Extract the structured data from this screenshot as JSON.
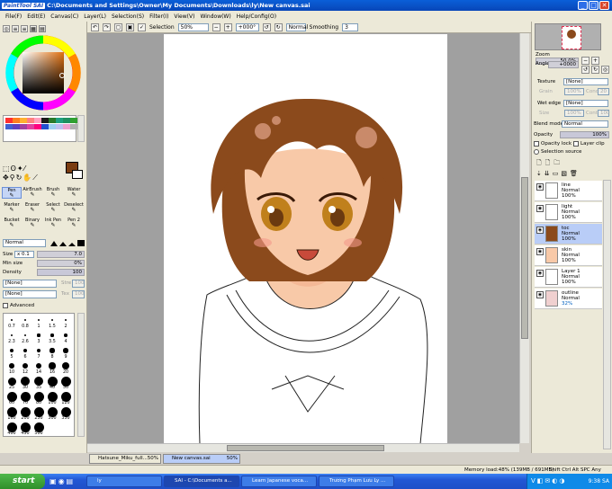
{
  "window": {
    "logo": "PaintTool SAI",
    "title": "C:\\Documents and Settings\\Owner\\My Documents\\Downloads\\ly\\New canvas.sai",
    "minimize": "_",
    "maximize": "□",
    "close": "✕"
  },
  "menu": [
    "File(F)",
    "Edit(E)",
    "Canvas(C)",
    "Layer(L)",
    "Selection(S)",
    "Filter(I)",
    "View(V)",
    "Window(W)",
    "Help/Config(O)"
  ],
  "toolbar": {
    "selection_label": "Selection",
    "zoom": "50%",
    "angle": "+000°",
    "blend": "Normal",
    "smoothing_label": "Smoothing",
    "smoothing": "3"
  },
  "colors": {
    "accent": "#0a5fd8",
    "brown": "#7a3c10",
    "hair": "#8b4a1c",
    "skin": "#f8c9a8",
    "eyes": "#c0801c"
  },
  "palette": [
    "#ff3030",
    "#ff8020",
    "#ffb030",
    "#ff8080",
    "#ffa0c0",
    "#1a1a1a",
    "#2a7a2a",
    "#20a080",
    "#209060",
    "#30a030",
    "#4060d0",
    "#6040c0",
    "#a040a0",
    "#e040a0",
    "#ff0080",
    "#2050d0",
    "#a0d0f0",
    "#c0c0f0",
    "#f0a0d0",
    "#b0b0b0"
  ],
  "tools": {
    "row1": [
      "Pen",
      "AirBrush",
      "Brush",
      "Water"
    ],
    "row2": [
      "Marker",
      "Eraser",
      "Select",
      "Deselect"
    ],
    "row3": [
      "Bucket",
      "Binary",
      "Ink Pen",
      "Pen 2"
    ]
  },
  "brush": {
    "mode": "Normal",
    "size_label": "Size",
    "size_mult": "x 0.1",
    "size_value": "7.0",
    "minsize_label": "Min size",
    "minsize_value": "0%",
    "density_label": "Density",
    "density_value": "100",
    "none1": "[None]",
    "none2": "[None]",
    "stre_label": "Stre",
    "stre_value": "100",
    "tex_label": "Tex",
    "tex_value": "100",
    "advanced_label": "Advanced"
  },
  "brush_sizes": [
    "0.7",
    "0.8",
    "1",
    "1.5",
    "2",
    "2.3",
    "2.6",
    "3",
    "3.5",
    "4",
    "5",
    "6",
    "7",
    "8",
    "9",
    "10",
    "12",
    "14",
    "16",
    "20",
    "25",
    "30",
    "35",
    "40",
    "50",
    "60",
    "70",
    "80",
    "100",
    "120",
    "160",
    "200",
    "250",
    "300",
    "350",
    "400",
    "450",
    "500"
  ],
  "navigator": {
    "zoom_label": "Zoom",
    "zoom_value": "50.0%",
    "angle_label": "Angle",
    "angle_value": "+0000"
  },
  "layer_props": {
    "texture_label": "Texture",
    "texture_value": "[None]",
    "grain_label": "Grain",
    "grain_value": "100%",
    "conc_label": "Conc",
    "conc_value": "20",
    "wet_edge_label": "Wet edge",
    "wet_edge_value": "[None]",
    "size_label": "Size",
    "size_value": "100%",
    "cont_label": "Cont",
    "cont_value": "100"
  },
  "layer_panel": {
    "blend_label": "Blend mode",
    "blend_value": "Normal",
    "opacity_label": "Opacity",
    "opacity_value": "100%",
    "opacity_lock": "Opacity lock",
    "layer_clip": "Layer clip",
    "selection_source": "Selection source"
  },
  "layers": [
    {
      "name": "line",
      "mode": "Normal",
      "opacity": "100%"
    },
    {
      "name": "light",
      "mode": "Normal",
      "opacity": "100%"
    },
    {
      "name": "toc",
      "mode": "Normal",
      "opacity": "100%"
    },
    {
      "name": "skin",
      "mode": "Normal",
      "opacity": "100%"
    },
    {
      "name": "Layer 1",
      "mode": "Normal",
      "opacity": "100%"
    },
    {
      "name": "outline",
      "mode": "Normal",
      "opacity": "32%"
    }
  ],
  "doctabs": [
    {
      "name": "Hatsune_Miku_full...",
      "zoom": "50%"
    },
    {
      "name": "New canvas.sai",
      "zoom": "50%"
    }
  ],
  "status": {
    "memory": "Memory load:48% (139MB / 691MB)",
    "keys": "Shift Ctrl Alt SPC Any"
  },
  "taskbar": {
    "start": "start",
    "items": [
      "ly",
      "SAI - C:\\Documents a...",
      "Learn Japanese voca...",
      "Trương Phạm Lưu Ly ..."
    ],
    "clock": "9:38 SA"
  }
}
